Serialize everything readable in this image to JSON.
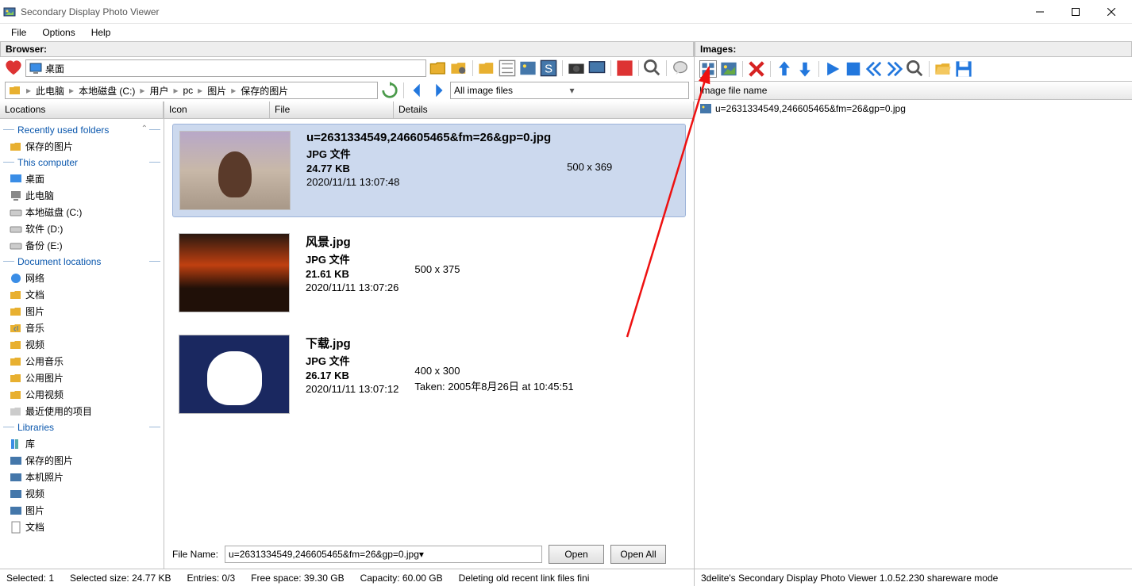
{
  "window": {
    "title": "Secondary Display Photo Viewer"
  },
  "menu": {
    "file": "File",
    "options": "Options",
    "help": "Help"
  },
  "browser": {
    "header": "Browser:",
    "desktop_label": "桌面",
    "breadcrumb": [
      "此电脑",
      "本地磁盘 (C:)",
      "用户",
      "pc",
      "图片",
      "保存的图片"
    ],
    "filter": "All image files",
    "columns": {
      "locations": "Locations",
      "icon": "Icon",
      "file": "File",
      "details": "Details"
    }
  },
  "sidebar": {
    "groups": {
      "recent": "Recently used folders",
      "this_computer": "This computer",
      "documents": "Document locations",
      "libraries": "Libraries"
    },
    "recent_items": [
      "保存的图片"
    ],
    "computer_items": [
      "桌面",
      "此电脑",
      "本地磁盘 (C:)",
      "软件 (D:)",
      "备份 (E:)"
    ],
    "document_items": [
      "网络",
      "文档",
      "图片",
      "音乐",
      "视频",
      "公用音乐",
      "公用图片",
      "公用视频",
      "最近使用的项目"
    ],
    "library_items": [
      "库",
      "保存的图片",
      "本机照片",
      "视频",
      "图片",
      "文档"
    ]
  },
  "files": [
    {
      "name": "u=2631334549,246605465&fm=26&gp=0.jpg",
      "type": "JPG 文件",
      "size": "24.77 KB",
      "date": "2020/11/11 13:07:48",
      "dims": "500 x 369",
      "taken": "",
      "selected": true
    },
    {
      "name": "风景.jpg",
      "type": "JPG 文件",
      "size": "21.61 KB",
      "date": "2020/11/11 13:07:26",
      "dims": "500 x 375",
      "taken": "",
      "selected": false
    },
    {
      "name": "下载.jpg",
      "type": "JPG 文件",
      "size": "26.17 KB",
      "date": "2020/11/11 13:07:12",
      "dims": "400 x 300",
      "taken": "Taken: 2005年8月26日 at 10:45:51",
      "selected": false
    }
  ],
  "filename_row": {
    "label": "File Name:",
    "value": "u=2631334549,246605465&fm=26&gp=0.jpg",
    "open": "Open",
    "open_all": "Open All"
  },
  "status": {
    "selected": "Selected: 1",
    "selected_size": "Selected size: 24.77 KB",
    "entries": "Entries: 0/3",
    "free": "Free space: 39.30 GB",
    "capacity": "Capacity: 60.00 GB",
    "deleting": "Deleting old recent link files fini"
  },
  "images_panel": {
    "header": "Images:",
    "col_header": "Image file name",
    "items": [
      "u=2631334549,246605465&fm=26&gp=0.jpg"
    ],
    "status": "3delite's Secondary Display Photo Viewer 1.0.52.230 shareware mode"
  }
}
